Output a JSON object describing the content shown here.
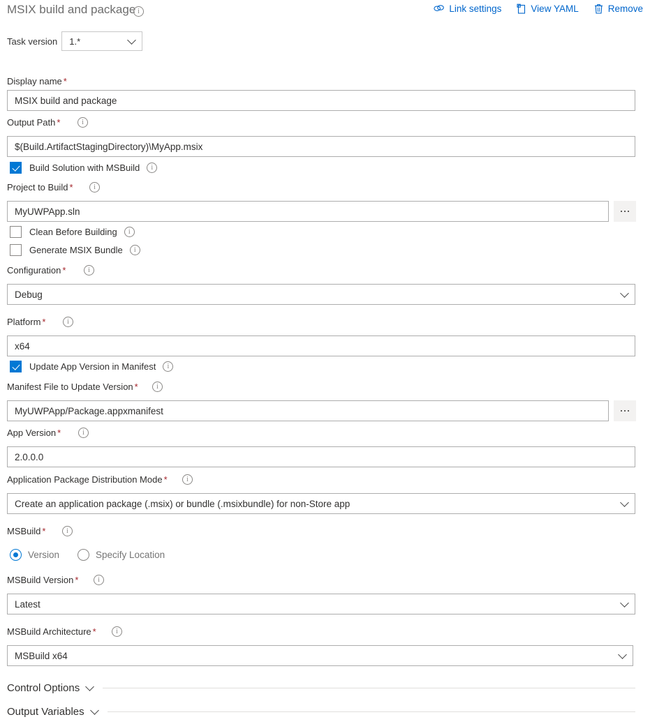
{
  "header": {
    "title": "MSIX build and package",
    "info_icon": "info-icon",
    "actions": [
      {
        "label": "Link settings",
        "icon": "link-icon"
      },
      {
        "label": "View YAML",
        "icon": "clipboard-icon"
      },
      {
        "label": "Remove",
        "icon": "trash-icon"
      }
    ]
  },
  "task_version": {
    "label": "Task version",
    "value": "1.*"
  },
  "fields": {
    "display_name": {
      "label": "Display name",
      "required": "*",
      "value": "MSIX build and package"
    },
    "output_path": {
      "label": "Output Path",
      "required": "*",
      "value": "$(Build.ArtifactStagingDirectory)\\MyApp.msix"
    },
    "build_solution": {
      "label": "Build Solution with MSBuild",
      "checked": true
    },
    "project_to_build": {
      "label": "Project to Build",
      "required": "*",
      "value": "MyUWPApp.sln",
      "browse": "..."
    },
    "clean_before_building": {
      "label": "Clean Before Building",
      "checked": false
    },
    "generate_msix_bundle": {
      "label": "Generate MSIX Bundle",
      "checked": false
    },
    "configuration": {
      "label": "Configuration",
      "required": "*",
      "value": "Debug"
    },
    "platform": {
      "label": "Platform",
      "required": "*",
      "value": "x64"
    },
    "update_app_version": {
      "label": "Update App Version in Manifest",
      "checked": true
    },
    "manifest_file": {
      "label": "Manifest File to Update Version",
      "required": "*",
      "value": "MyUWPApp/Package.appxmanifest",
      "browse": "..."
    },
    "app_version": {
      "label": "App Version",
      "required": "*",
      "value": "2.0.0.0"
    },
    "distribution_mode": {
      "label": "Application Package Distribution Mode",
      "required": "*",
      "value": "Create an application package (.msix) or bundle (.msixbundle) for non-Store app"
    },
    "msbuild": {
      "label": "MSBuild",
      "required": "*",
      "options": [
        {
          "label": "Version",
          "selected": true
        },
        {
          "label": "Specify Location",
          "selected": false
        }
      ]
    },
    "msbuild_version": {
      "label": "MSBuild Version",
      "required": "*",
      "value": "Latest"
    },
    "msbuild_architecture": {
      "label": "MSBuild Architecture",
      "required": "*",
      "value": "MSBuild x64"
    }
  },
  "sections": [
    {
      "label": "Control Options"
    },
    {
      "label": "Output Variables"
    }
  ],
  "colors": {
    "accent": "#0078d4",
    "link": "#0066cc",
    "required": "#a4262c",
    "border": "#adadad",
    "text": "#323130"
  }
}
